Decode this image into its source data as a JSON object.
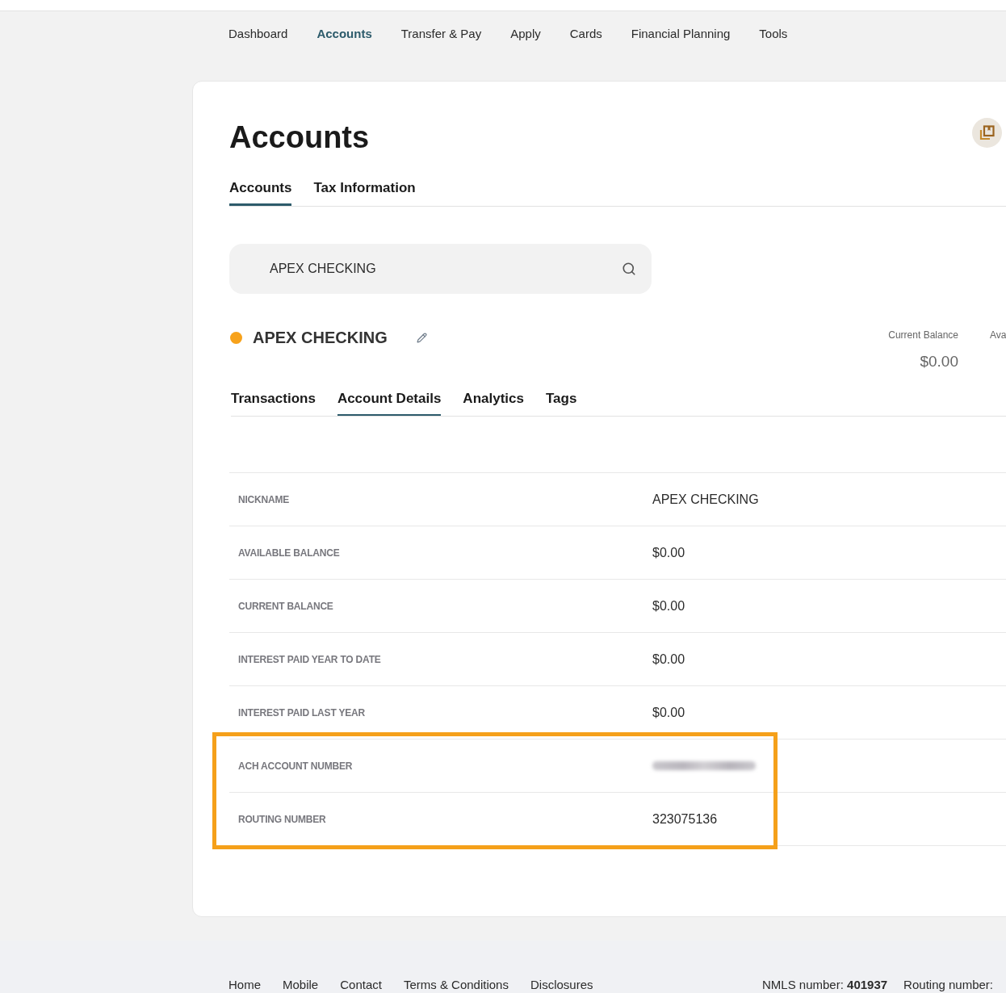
{
  "nav": [
    {
      "label": "Dashboard",
      "selected": false
    },
    {
      "label": "Accounts",
      "selected": true
    },
    {
      "label": "Transfer & Pay",
      "selected": false
    },
    {
      "label": "Apply",
      "selected": false
    },
    {
      "label": "Cards",
      "selected": false
    },
    {
      "label": "Financial Planning",
      "selected": false
    },
    {
      "label": "Tools",
      "selected": false
    }
  ],
  "page": {
    "title": "Accounts"
  },
  "tabs": [
    {
      "label": "Accounts",
      "selected": true
    },
    {
      "label": "Tax Information",
      "selected": false
    }
  ],
  "search": {
    "value": "APEX CHECKING"
  },
  "account": {
    "name": "APEX CHECKING",
    "color": "#f7a21b",
    "balances": [
      {
        "label": "Current Balance",
        "amount": "$0.00"
      },
      {
        "label": "Ava"
      }
    ]
  },
  "subtabs": [
    {
      "label": "Transactions",
      "selected": false
    },
    {
      "label": "Account Details",
      "selected": true
    },
    {
      "label": "Analytics",
      "selected": false
    },
    {
      "label": "Tags",
      "selected": false
    }
  ],
  "details": {
    "rows": [
      {
        "label": "NICKNAME",
        "value": "APEX CHECKING",
        "redacted": false,
        "highlighted": false
      },
      {
        "label": "AVAILABLE BALANCE",
        "value": "$0.00",
        "redacted": false,
        "highlighted": false
      },
      {
        "label": "CURRENT BALANCE",
        "value": "$0.00",
        "redacted": false,
        "highlighted": false
      },
      {
        "label": "INTEREST PAID YEAR TO DATE",
        "value": "$0.00",
        "redacted": false,
        "highlighted": false
      },
      {
        "label": "INTEREST PAID LAST YEAR",
        "value": "$0.00",
        "redacted": false,
        "highlighted": false
      },
      {
        "label": "ACH ACCOUNT NUMBER",
        "redacted": true,
        "highlighted": true
      },
      {
        "label": "ROUTING NUMBER",
        "value": "323075136",
        "redacted": false,
        "highlighted": true
      }
    ]
  },
  "footer": {
    "links": [
      "Home",
      "Mobile",
      "Contact",
      "Terms & Conditions",
      "Disclosures"
    ],
    "info": [
      "NMLS number: **401937**",
      "Routing number:"
    ]
  }
}
